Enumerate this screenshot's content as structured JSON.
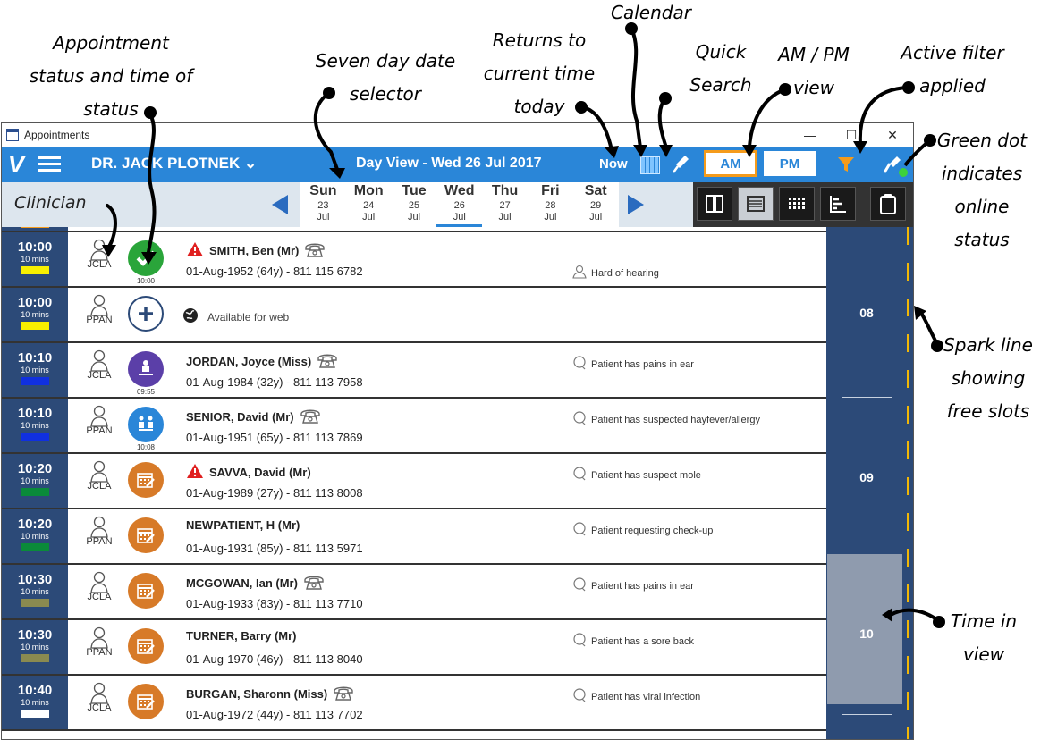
{
  "annotations": {
    "appointment_status": "Appointment\nstatus and time of\nstatus",
    "seven_day": "Seven day date\nselector",
    "returns_now": "Returns to\ncurrent time\ntoday",
    "calendar": "Calendar",
    "quick_search": "Quick\nSearch",
    "ampm_view": "AM / PM\nview",
    "active_filter": "Active filter\napplied",
    "green_dot": "Green dot\nindicates\nonline\nstatus",
    "spark_line": "Spark line\nshowing\nfree slots",
    "time_in_view": "Time in\nview",
    "clinician": "Clinician"
  },
  "window": {
    "title": "Appointments",
    "minimize": "—",
    "maximize": "☐",
    "close": "✕"
  },
  "topbar": {
    "clinician": "DR. JACK PLOTNEK ⌄",
    "day_view": "Day View - Wed 26 Jul 2017",
    "now": "Now",
    "am": "AM",
    "pm": "PM"
  },
  "days": [
    {
      "name": "Sun",
      "date": "23",
      "month": "Jul",
      "selected": false
    },
    {
      "name": "Mon",
      "date": "24",
      "month": "Jul",
      "selected": false
    },
    {
      "name": "Tue",
      "date": "25",
      "month": "Jul",
      "selected": false
    },
    {
      "name": "Wed",
      "date": "26",
      "month": "Jul",
      "selected": true
    },
    {
      "name": "Thu",
      "date": "27",
      "month": "Jul",
      "selected": false
    },
    {
      "name": "Fri",
      "date": "28",
      "month": "Jul",
      "selected": false
    },
    {
      "name": "Sat",
      "date": "29",
      "month": "Jul",
      "selected": false
    }
  ],
  "appointments": [
    {
      "time": "10:00",
      "dur": "10 mins",
      "bar": "#f7ef00",
      "clinician": "JCLA",
      "status": "arrived",
      "status_time": "10:00",
      "alert": true,
      "phone": true,
      "name": "SMITH, Ben (Mr)",
      "detail": "01-Aug-1952 (64y) - 811 115 6782",
      "note": "Hard of hearing",
      "note_icon": "person"
    },
    {
      "time": "10:00",
      "dur": "10 mins",
      "bar": "#f7ef00",
      "clinician": "PPAN",
      "status": "available",
      "status_time": "",
      "alert": false,
      "phone": false,
      "name": "",
      "detail": "",
      "note": "",
      "note_icon": "",
      "avail": "Available for web"
    },
    {
      "time": "10:10",
      "dur": "10 mins",
      "bar": "#1030e0",
      "clinician": "JCLA",
      "status": "waiting",
      "status_time": "09:55",
      "alert": false,
      "phone": true,
      "name": "JORDAN, Joyce (Miss)",
      "detail": "01-Aug-1984 (32y) - 811 113 7958",
      "note": "Patient has pains in ear",
      "note_icon": "bubble"
    },
    {
      "time": "10:10",
      "dur": "10 mins",
      "bar": "#1030e0",
      "clinician": "PPAN",
      "status": "in-consultation",
      "status_time": "10:08",
      "alert": false,
      "phone": true,
      "name": "SENIOR, David (Mr)",
      "detail": "01-Aug-1951 (65y) - 811 113 7869",
      "note": "Patient has suspected hayfever/allergy",
      "note_icon": "bubble"
    },
    {
      "time": "10:20",
      "dur": "10 mins",
      "bar": "#0a8a3a",
      "clinician": "JCLA",
      "status": "booked",
      "status_time": "",
      "alert": true,
      "phone": false,
      "name": "SAVVA, David (Mr)",
      "detail": "01-Aug-1989 (27y) - 811 113 8008",
      "note": "Patient has suspect mole",
      "note_icon": "bubble"
    },
    {
      "time": "10:20",
      "dur": "10 mins",
      "bar": "#0a8a3a",
      "clinician": "PPAN",
      "status": "booked",
      "status_time": "",
      "alert": false,
      "phone": false,
      "name": "NEWPATIENT, H (Mr)",
      "detail": "01-Aug-1931 (85y) - 811 113 5971",
      "note": "Patient requesting check-up",
      "note_icon": "bubble"
    },
    {
      "time": "10:30",
      "dur": "10 mins",
      "bar": "#8a8a50",
      "clinician": "JCLA",
      "status": "booked",
      "status_time": "",
      "alert": false,
      "phone": true,
      "name": "MCGOWAN, Ian (Mr)",
      "detail": "01-Aug-1933 (83y) - 811 113 7710",
      "note": "Patient has pains in ear",
      "note_icon": "bubble"
    },
    {
      "time": "10:30",
      "dur": "10 mins",
      "bar": "#8a8a50",
      "clinician": "PPAN",
      "status": "booked",
      "status_time": "",
      "alert": false,
      "phone": false,
      "name": "TURNER, Barry (Mr)",
      "detail": "01-Aug-1970 (46y) - 811 113 8040",
      "note": "Patient has a sore back",
      "note_icon": "bubble"
    },
    {
      "time": "10:40",
      "dur": "10 mins",
      "bar": "#ffffff",
      "clinician": "JCLA",
      "status": "booked",
      "status_time": "",
      "alert": false,
      "phone": true,
      "name": "BURGAN, Sharonn (Miss)",
      "detail": "01-Aug-1972 (44y) - 811 113 7702",
      "note": "Patient has viral infection",
      "note_icon": "bubble"
    }
  ],
  "spark": {
    "hours": [
      "08",
      "09",
      "10"
    ]
  },
  "colors": {
    "topbar": "#2a86d8",
    "time_col": "#2c4a78",
    "accent_orange": "#f59b1b",
    "arrived": "#2aa53a",
    "waiting": "#5b3fa8",
    "in_consult": "#2a86d8",
    "booked": "#d77a28"
  }
}
